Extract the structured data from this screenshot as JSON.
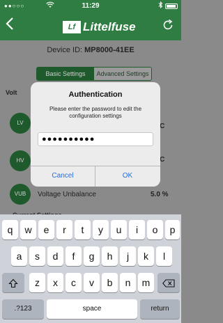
{
  "status_bar": {
    "signal": "●●○○○",
    "time": "11:29"
  },
  "nav": {
    "logo_mark": "Lf",
    "logo_text": "Littelfuse"
  },
  "device": {
    "prefix": "Device ID: ",
    "id": "MP8000-41EE"
  },
  "tabs": {
    "basic": "Basic Settings",
    "advanced": "Advanced Settings"
  },
  "section": {
    "voltage_label": "Volt",
    "current_label": "Current Settings"
  },
  "rows": [
    {
      "badge": "LV",
      "value": "VAC"
    },
    {
      "badge": "HV",
      "value": "VAC"
    },
    {
      "badge": "VUB",
      "label": "Voltage  Unbalance",
      "value": "5.0 %"
    }
  ],
  "dialog": {
    "title": "Authentication",
    "message": "Please enter the password to edit the configuration settings",
    "password_value": "●●●●●●●●●●",
    "cancel_label": "Cancel",
    "ok_label": "OK"
  },
  "keyboard": {
    "row1": [
      "q",
      "w",
      "e",
      "r",
      "t",
      "y",
      "u",
      "i",
      "o",
      "p"
    ],
    "row2": [
      "a",
      "s",
      "d",
      "f",
      "g",
      "h",
      "j",
      "k",
      "l"
    ],
    "row3": [
      "z",
      "x",
      "c",
      "v",
      "b",
      "n",
      "m"
    ],
    "numbers_label": ".?123",
    "space_label": "space",
    "return_label": "return"
  },
  "colors": {
    "brand_green": "#2f7d42",
    "link_blue": "#2a6bd8"
  }
}
